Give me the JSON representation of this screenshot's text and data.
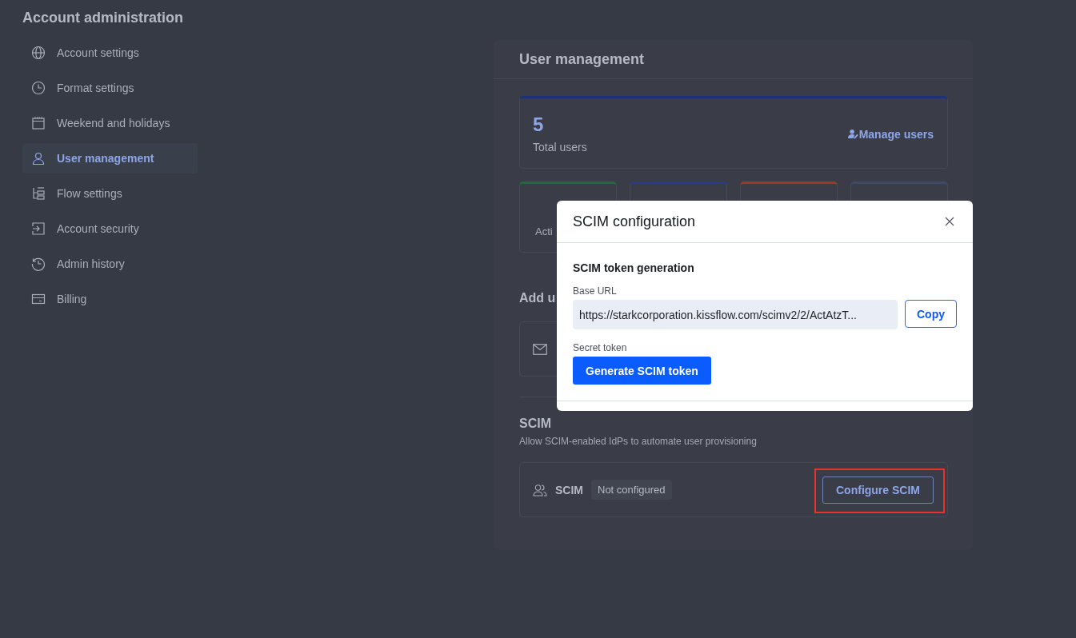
{
  "sidebar": {
    "title": "Account administration",
    "items": [
      {
        "label": "Account settings",
        "selected": false
      },
      {
        "label": "Format settings",
        "selected": false
      },
      {
        "label": "Weekend and holidays",
        "selected": false
      },
      {
        "label": "User management",
        "selected": true
      },
      {
        "label": "Flow settings",
        "selected": false
      },
      {
        "label": "Account security",
        "selected": false
      },
      {
        "label": "Admin history",
        "selected": false
      },
      {
        "label": "Billing",
        "selected": false
      }
    ]
  },
  "panel": {
    "title": "User management",
    "total": {
      "count": "5",
      "label": "Total users",
      "link": "Manage users"
    },
    "stat_cards": [
      {
        "label": "Acti",
        "color": "#1f6b3a"
      },
      {
        "color": "#2b3a8c"
      },
      {
        "color": "#9a3a24"
      },
      {
        "color": "#3e4a63"
      }
    ],
    "add_users": {
      "title": "Add u"
    },
    "scim": {
      "title": "SCIM",
      "description": "Allow SCIM-enabled IdPs to automate user provisioning",
      "name": "SCIM",
      "status": "Not configured",
      "button": "Configure SCIM",
      "highlighted": true
    }
  },
  "dialog": {
    "title": "SCIM configuration",
    "section": "SCIM token generation",
    "url_label": "Base URL",
    "url_value": "https://starkcorporation.kissflow.com/scimv2/2/ActAtzT...",
    "copy": "Copy",
    "token_label": "Secret token",
    "generate": "Generate SCIM token"
  }
}
